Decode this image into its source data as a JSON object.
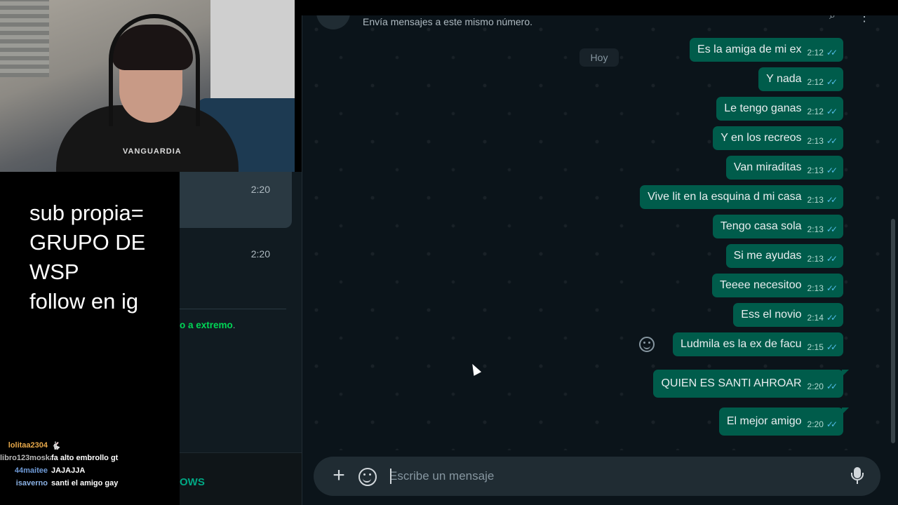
{
  "webcam": {
    "shirt_text": "VANGUARDIA"
  },
  "overlay": {
    "promo_lines": [
      "sub propia=",
      "GRUPO DE WSP",
      "follow en ig"
    ]
  },
  "stream_chat": [
    {
      "user": "lolitaa2304",
      "user_color": "#e8a94a",
      "message": "🐇"
    },
    {
      "user": "libro123moska",
      "user_color": "#b9b9b9",
      "message": "fa alto embrollo gt"
    },
    {
      "user": "44maitee",
      "user_color": "#6f9bd8",
      "message": "JAJAJJA"
    },
    {
      "user": "isaverno",
      "user_color": "#8cb3e6",
      "message": "santi el amigo gay"
    }
  ],
  "chat_list": {
    "row1_time": "2:20",
    "row2_time": "2:20",
    "encryption_snippet": "o a extremo",
    "encryption_suffix": ".",
    "bottom_label": "OWS"
  },
  "conversation": {
    "header_subtitle": "Envía mensajes a este mismo número.",
    "day_chip": "Hoy",
    "messages": [
      {
        "text": "Es la amiga de mi ex",
        "time": "2:12",
        "ticks": "✓✓"
      },
      {
        "text": "Y nada",
        "time": "2:12",
        "ticks": "✓✓"
      },
      {
        "text": "Le tengo ganas",
        "time": "2:12",
        "ticks": "✓✓"
      },
      {
        "text": "Y en los recreos",
        "time": "2:13",
        "ticks": "✓✓"
      },
      {
        "text": "Van miraditas",
        "time": "2:13",
        "ticks": "✓✓"
      },
      {
        "text": "Vive lit en la esquina d mi casa",
        "time": "2:13",
        "ticks": "✓✓"
      },
      {
        "text": "Tengo casa sola",
        "time": "2:13",
        "ticks": "✓✓"
      },
      {
        "text": "Si me ayudas",
        "time": "2:13",
        "ticks": "✓✓"
      },
      {
        "text": "Teeee necesitoo",
        "time": "2:13",
        "ticks": "✓✓"
      },
      {
        "text": "Ess el novio",
        "time": "2:14",
        "ticks": "✓✓"
      },
      {
        "text": "Ludmila es la ex de facu",
        "time": "2:15",
        "ticks": "✓✓"
      },
      {
        "text": "QUIEN ES SANTI AHROAR",
        "time": "2:20",
        "ticks": "✓✓"
      },
      {
        "text": "El mejor amigo",
        "time": "2:20",
        "ticks": "✓✓"
      }
    ]
  },
  "composer": {
    "placeholder": "Escribe un mensaje"
  },
  "colors": {
    "bubble_out": "#005c4b",
    "read_ticks": "#53bdeb",
    "background": "#0b141a",
    "accent": "#00a884"
  },
  "icons": [
    "plus-icon",
    "sticker-icon",
    "mic-icon",
    "emoji-react-icon",
    "search-icon",
    "menu-icon"
  ]
}
